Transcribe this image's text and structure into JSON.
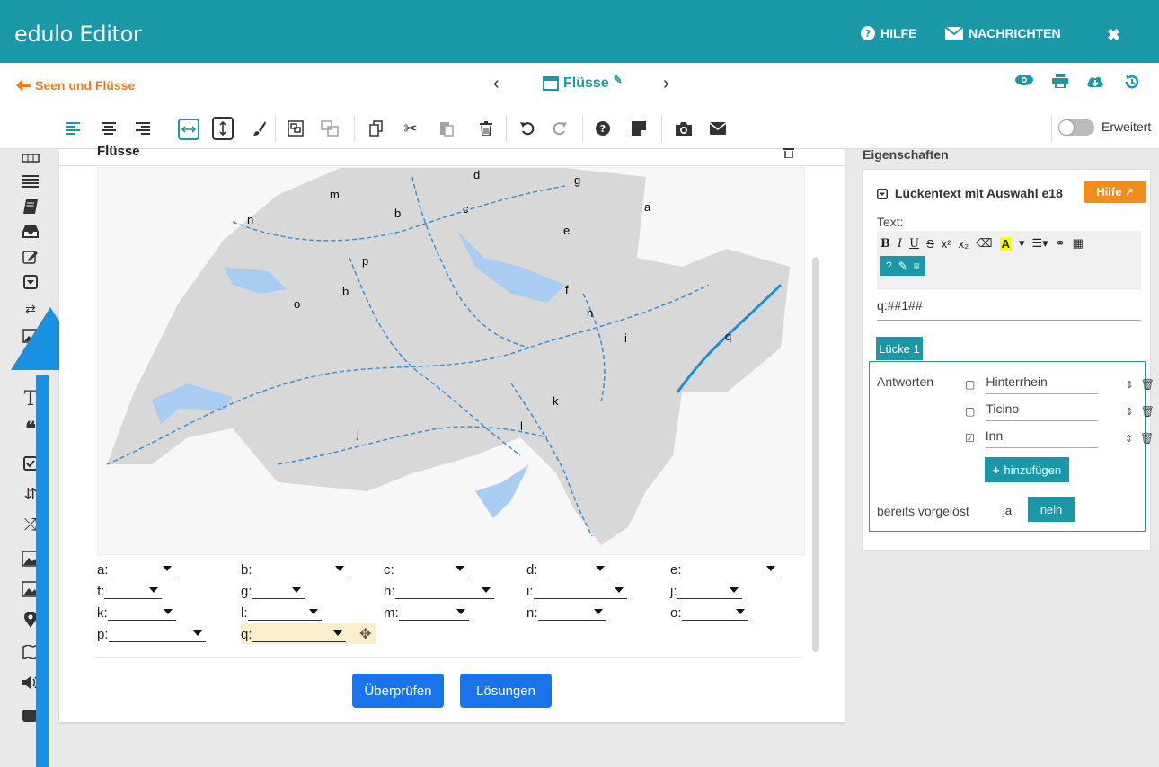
{
  "app": {
    "title": "edulo Editor",
    "help": "HILFE",
    "messages": "NACHRICHTEN"
  },
  "nav": {
    "back": "Seen und Flüsse",
    "doc_title": "Flüsse"
  },
  "toolbar": {
    "extended_label": "Erweitert"
  },
  "panel": {
    "title": "Flüsse"
  },
  "map_labels": [
    "a",
    "b",
    "b",
    "c",
    "d",
    "e",
    "f",
    "g",
    "h",
    "i",
    "j",
    "k",
    "l",
    "m",
    "n",
    "o",
    "p",
    "q"
  ],
  "questions": {
    "a": "a:",
    "b": "b:",
    "c": "c:",
    "d": "d:",
    "e": "e:",
    "f": "f:",
    "g": "g:",
    "h": "h:",
    "i": "i:",
    "j": "j:",
    "k": "k:",
    "l": "l:",
    "m": "m:",
    "n": "n:",
    "o": "o:",
    "p": "p:",
    "q": "q:"
  },
  "buttons": {
    "check": "Überprüfen",
    "solutions": "Lösungen"
  },
  "properties": {
    "heading": "Eigenschaften",
    "title": "Lückentext mit Auswahl e18",
    "help": "Hilfe",
    "text_label": "Text:",
    "rte_labels": [
      "B",
      "I",
      "U",
      "S",
      "x²",
      "x₂"
    ],
    "editor_text": "q:##1##",
    "tab": "Lücke 1",
    "answers_label": "Antworten",
    "answers": [
      {
        "text": "Hinterrhein",
        "checked": false
      },
      {
        "text": "Ticino",
        "checked": false
      },
      {
        "text": "Inn",
        "checked": true
      }
    ],
    "add": "hinzufügen",
    "presolved_label": "bereits vorgelöst",
    "yes": "ja",
    "no": "nein"
  },
  "colors": {
    "teal": "#1a98a8",
    "orange": "#f07d1c",
    "blue": "#1a73e8"
  }
}
